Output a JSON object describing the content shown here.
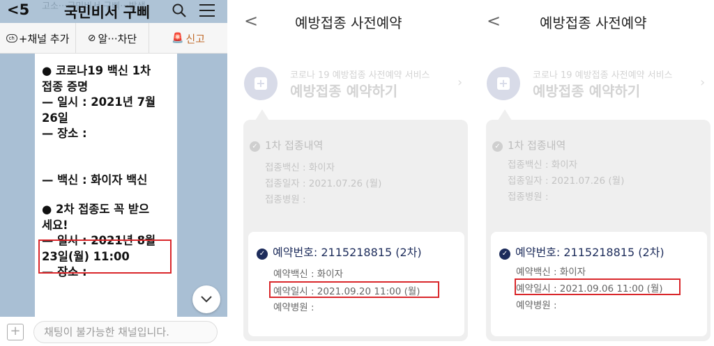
{
  "chat": {
    "ghost_text": "고소···국민비서 구삐···발생",
    "back_label": "<",
    "back_count": "5",
    "title": "국민비서 구삐",
    "icons": {
      "search": "search-icon",
      "menu": "menu-icon"
    },
    "actions": [
      {
        "icon": "ch",
        "label": "+채널 추가"
      },
      {
        "icon": "⊘",
        "label": "알···차단"
      },
      {
        "icon": "🚨",
        "label": "신고"
      }
    ],
    "message_lines": [
      "● 코로나19 백신 1차",
      "접종 증명",
      "— 일시 : 2021년 7월",
      "26일",
      "— 장소 :",
      "— 백신 : 화이자 백신",
      "● 2차 접종도 꼭 받으",
      "세요!",
      "— 일시 : 2021년 8월",
      "23일(월) 11:00",
      "—  장소 :"
    ],
    "input_placeholder": "채팅이 불가능한 채널입니다.",
    "highlight_color": "#d9262a"
  },
  "panels": [
    {
      "back_label": "<",
      "title": "예방접종 사전예약",
      "service_sub": "코로나 19 예방접종 사전예약 서비스",
      "service_main": "예방접종 예약하기",
      "dose1": {
        "title": "1차 접종내역",
        "vaccine": "접종백신 : 화이자",
        "date": "접종일자 : 2021.07.26 (월)",
        "hospital": "접종병원 :"
      },
      "reservation": {
        "number": "예약번호: 2115218815 (2차)",
        "vaccine": "예약백신 : 화이자",
        "datetime": "예약일시 : 2021.09.20 11:00 (월)",
        "hospital": "예약병원 :"
      }
    },
    {
      "back_label": "<",
      "title": "예방접종 사전예약",
      "service_sub": "코로나 19 예방접종 사전예약 서비스",
      "service_main": "예방접종 예약하기",
      "dose1": {
        "title": "1차 접종내역",
        "vaccine": "접종백신 : 화이자",
        "date": "접종일자 : 2021.07.26 (월)",
        "hospital": "접종병원 :"
      },
      "reservation": {
        "number": "예약번호: 2115218815 (2차)",
        "vaccine": "예약백신 : 화이자",
        "datetime": "예약일시 : 2021.09.06 11:00 (월)",
        "hospital": "예약병원 :"
      }
    }
  ],
  "colors": {
    "navy": "#1d2c5b",
    "highlight": "#d9262a",
    "chat_bg": "#a9bfd4"
  }
}
